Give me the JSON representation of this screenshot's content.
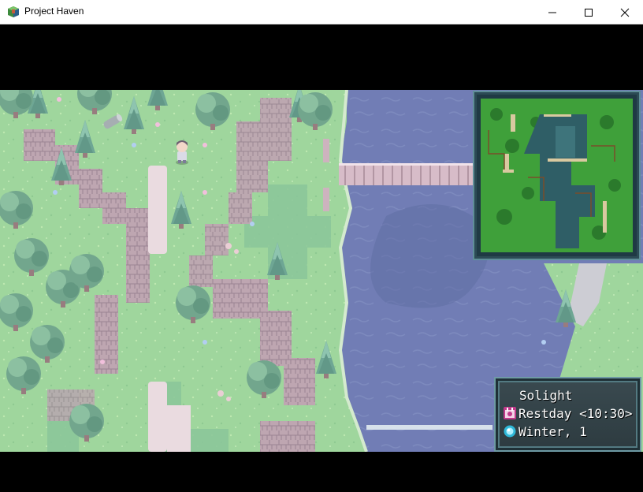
{
  "window": {
    "title": "Project Haven",
    "controls": [
      "minimize",
      "maximize",
      "close"
    ]
  },
  "hud": {
    "location": "Solight",
    "day_line": "Restday <10:30>",
    "season_line": "Winter, 1",
    "day_icon": "calendar-icon",
    "season_icon": "snowflake-orb-icon"
  },
  "map": {
    "player": "player-character",
    "terrain": [
      "grass",
      "cliffs",
      "pine-trees",
      "river",
      "wooden-bridge",
      "dirt-path"
    ],
    "colors": {
      "grass": "#8fd08a",
      "grass_dark": "#6fb78a",
      "water": "#5c6aa8",
      "water_deep": "#4a5796",
      "cliff": "#b89aa8",
      "bridge": "#c8a8b8"
    }
  },
  "minimap": {
    "colors": {
      "forest": "#3fa03a",
      "water": "#2f5e66",
      "path": "#d9c9a0"
    }
  }
}
